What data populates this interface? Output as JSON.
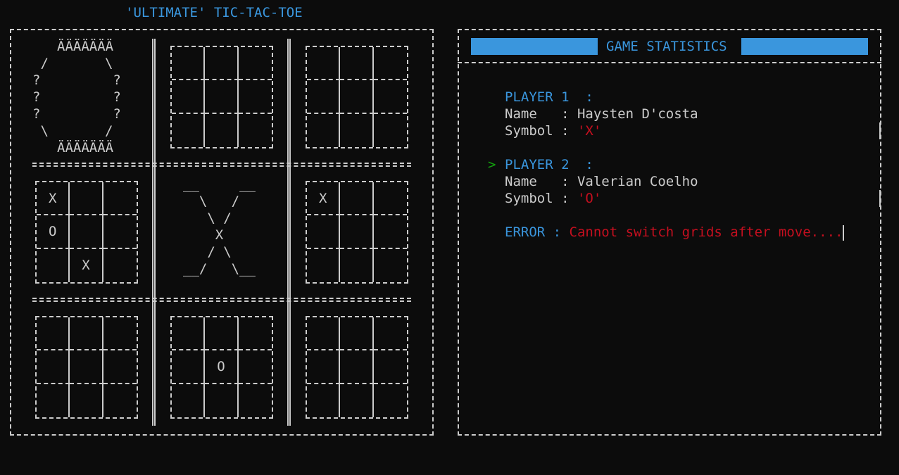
{
  "title": "'ULTIMATE' TIC-TAC-TOE",
  "board": {
    "grid_ascii": {
      "top": "ÄÄÄÄÄÄÄ",
      "l1": " /       \\",
      "l2": "?         ?",
      "l3": "?         ?",
      "l4": "?         ?",
      "l5": " \\       /",
      "bottom": "ÄÄÄÄÄÄÄ"
    },
    "big_x": {
      "l1": "__     __",
      "l2": "  \\   /",
      "l3": "   \\ /",
      "l4": "    X",
      "l5": "   / \\",
      "l6": "__/   \\__"
    },
    "grids": {
      "g2": [
        "",
        "",
        "",
        "",
        "",
        "",
        "",
        "",
        ""
      ],
      "g3": [
        "",
        "",
        "",
        "",
        "",
        "",
        "",
        "",
        ""
      ],
      "g4": [
        "X",
        "",
        "",
        "O",
        "",
        "",
        "",
        "X",
        ""
      ],
      "g6": [
        "X",
        "",
        "",
        "",
        "",
        "",
        "",
        "",
        ""
      ],
      "g7": [
        "",
        "",
        "",
        "",
        "",
        "",
        "",
        "",
        ""
      ],
      "g8": [
        "",
        "",
        "",
        "",
        "O",
        "",
        "",
        "",
        ""
      ],
      "g9": [
        "",
        "",
        "",
        "",
        "",
        "",
        "",
        "",
        ""
      ]
    }
  },
  "stats": {
    "header": "GAME STATISTICS",
    "player1": {
      "label": "PLAYER 1  :",
      "name_label": "Name   : ",
      "name": "Haysten D'costa",
      "symbol_label": "Symbol : ",
      "symbol": "'X'"
    },
    "player2": {
      "pointer": ">",
      "label": "PLAYER 2  :",
      "name_label": "Name   : ",
      "name": "Valerian Coelho",
      "symbol_label": "Symbol : ",
      "symbol": "'O'"
    },
    "error": {
      "label": "ERROR : ",
      "message": "Cannot switch grids after move...."
    }
  },
  "colors": {
    "background": "#0c0c0c",
    "text": "#cccccc",
    "accent_blue": "#3a96dd",
    "error_red": "#c50f1f",
    "pointer_green": "#13a10e"
  }
}
